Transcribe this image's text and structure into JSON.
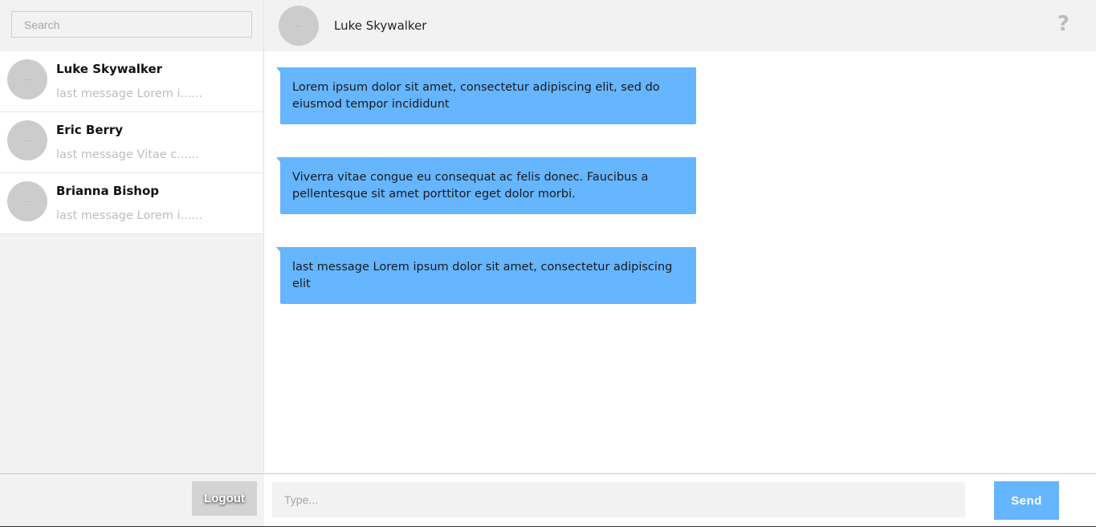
{
  "sidebar": {
    "search": {
      "placeholder": "Search",
      "value": ""
    },
    "contacts": [
      {
        "name": "Luke Skywalker",
        "preview": "last message Lorem i......",
        "avatar_icon": "avatar-placeholder-icon"
      },
      {
        "name": "Eric Berry",
        "preview": "last message Vitae c......",
        "avatar_icon": "avatar-placeholder-icon"
      },
      {
        "name": "Brianna Bishop",
        "preview": "last message Lorem i......",
        "avatar_icon": "avatar-placeholder-icon"
      }
    ],
    "logout_label": "Logout"
  },
  "chat": {
    "title": "Luke Skywalker",
    "help_label": "?",
    "help_icon": "question-mark-icon",
    "messages": [
      {
        "text": "Lorem ipsum dolor sit amet, consectetur adipiscing elit, sed do eiusmod tempor incididunt"
      },
      {
        "text": "Viverra vitae congue eu consequat ac felis donec. Faucibus a pellentesque sit amet porttitor eget dolor morbi."
      },
      {
        "text": "last message Lorem ipsum dolor sit amet, consectetur adipiscing elit"
      }
    ],
    "composer": {
      "placeholder": "Type...",
      "value": "",
      "send_label": "Send"
    }
  },
  "colors": {
    "accent": "#66b5ff",
    "panel_bg": "#f2f2f2",
    "avatar_bg": "#cccccc",
    "muted_text": "#bdbdbd"
  }
}
